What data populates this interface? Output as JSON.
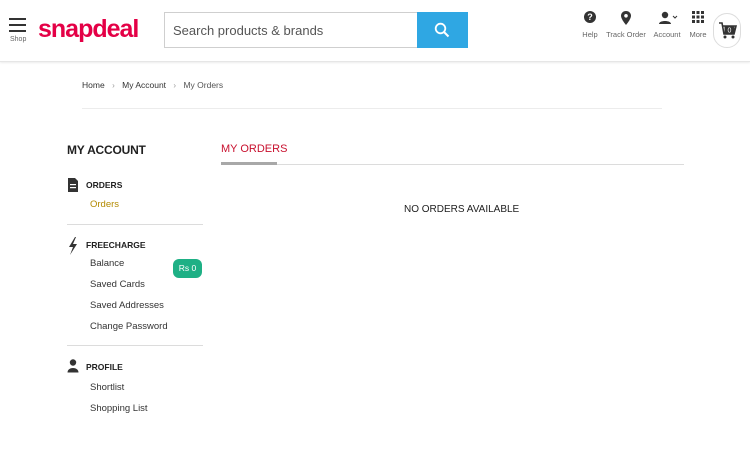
{
  "header": {
    "shop_label": "Shop",
    "logo": "snapdeal",
    "search_placeholder": "Search products & brands",
    "help_label": "Help",
    "track_order_label": "Track Order",
    "account_label": "Account",
    "more_label": "More",
    "cart_count": "0",
    "brand_color": "#e40046",
    "search_button_color": "#2fa7e3"
  },
  "breadcrumb": {
    "items": [
      "Home",
      "My Account",
      "My Orders"
    ]
  },
  "sidebar": {
    "title": "MY ACCOUNT",
    "orders": {
      "heading": "ORDERS",
      "links": [
        "Orders"
      ]
    },
    "freecharge": {
      "heading": "FREECHARGE",
      "links": [
        "Balance",
        "Saved Cards",
        "Saved Addresses",
        "Change Password"
      ],
      "balance_badge": "Rs 0"
    },
    "profile": {
      "heading": "PROFILE",
      "links": [
        "Shortlist",
        "Shopping List"
      ]
    }
  },
  "main": {
    "tab_label": "MY ORDERS",
    "empty_message": "NO ORDERS AVAILABLE"
  }
}
